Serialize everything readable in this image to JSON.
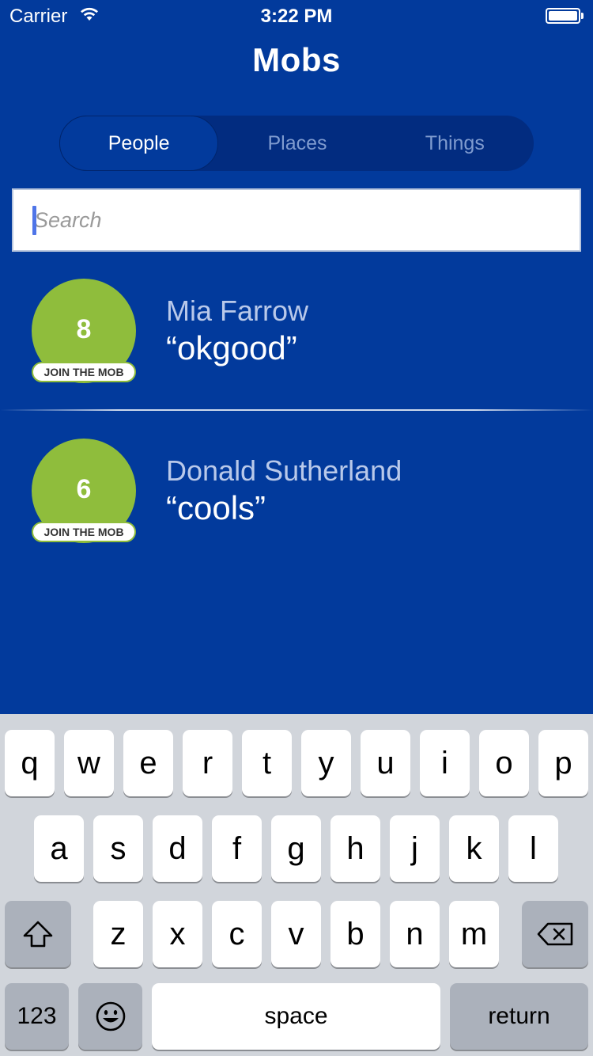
{
  "status_bar": {
    "carrier": "Carrier",
    "time": "3:22 PM",
    "wifi_icon": "wifi-icon",
    "battery_icon": "battery-icon"
  },
  "header": {
    "title": "Mobs"
  },
  "tabs": [
    {
      "label": "People",
      "active": true
    },
    {
      "label": "Places",
      "active": false
    },
    {
      "label": "Things",
      "active": false
    }
  ],
  "search": {
    "placeholder": "Search",
    "value": ""
  },
  "people": [
    {
      "count": "8",
      "join_label": "JOIN THE MOB",
      "name": "Mia Farrow",
      "quote": "“okgood”"
    },
    {
      "count": "6",
      "join_label": "JOIN THE MOB",
      "name": "Donald Sutherland",
      "quote": "“cools”"
    }
  ],
  "colors": {
    "background": "#023a9c",
    "segmented_bg": "#022c80",
    "badge_green": "#8fbd3c",
    "keyboard_bg": "#d1d5db"
  },
  "keyboard": {
    "row1": [
      "q",
      "w",
      "e",
      "r",
      "t",
      "y",
      "u",
      "i",
      "o",
      "p"
    ],
    "row2": [
      "a",
      "s",
      "d",
      "f",
      "g",
      "h",
      "j",
      "k",
      "l"
    ],
    "row3": [
      "z",
      "x",
      "c",
      "v",
      "b",
      "n",
      "m"
    ],
    "shift_icon": "shift-icon",
    "delete_icon": "delete-icon",
    "numbers_label": "123",
    "emoji_icon": "emoji-icon",
    "space_label": "space",
    "return_label": "return"
  }
}
